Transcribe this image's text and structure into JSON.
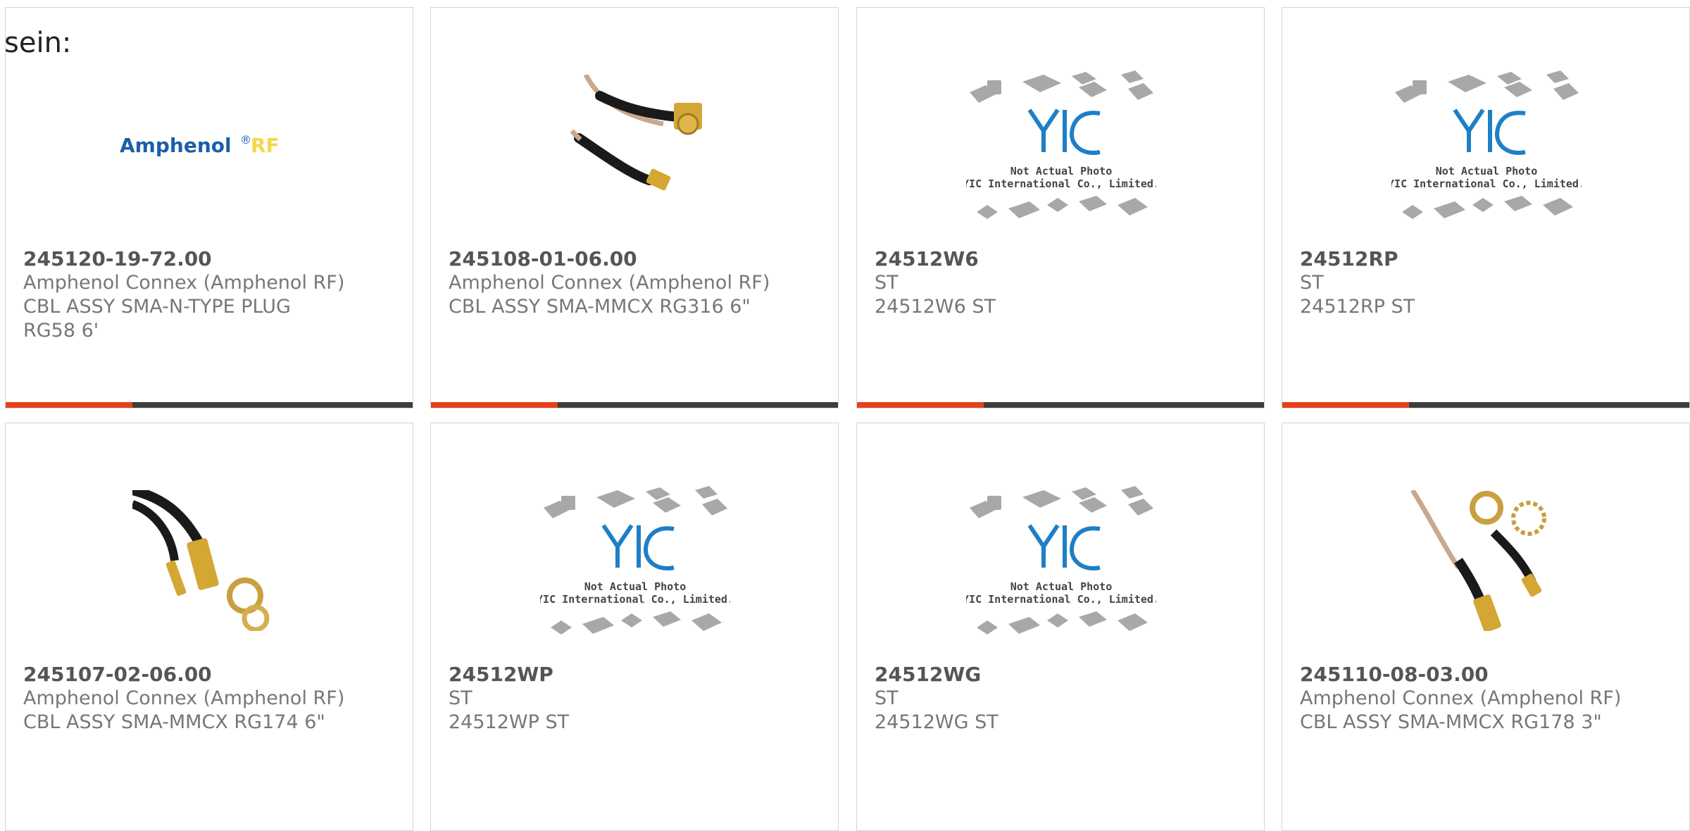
{
  "lead_text": "sein:",
  "products": [
    {
      "part_number": "245120-19-72.00",
      "manufacturer": "Amphenol Connex (Amphenol RF)",
      "description_1": "CBL ASSY SMA-N-TYPE PLUG",
      "description_2": "RG58 6'",
      "image": "amphenol-rf-logo"
    },
    {
      "part_number": "245108-01-06.00",
      "manufacturer": "Amphenol Connex (Amphenol RF)",
      "description_1": "CBL ASSY SMA-MMCX RG316 6\"",
      "description_2": "",
      "image": "cable-assembly-photo"
    },
    {
      "part_number": "24512W6",
      "manufacturer": "ST",
      "description_1": "24512W6 ST",
      "description_2": "",
      "image": "placeholder-photo"
    },
    {
      "part_number": "24512RP",
      "manufacturer": "ST",
      "description_1": "24512RP ST",
      "description_2": "",
      "image": "placeholder-photo"
    },
    {
      "part_number": "245107-02-06.00",
      "manufacturer": "Amphenol Connex (Amphenol RF)",
      "description_1": "CBL ASSY SMA-MMCX RG174 6\"",
      "description_2": "",
      "image": "cable-assembly-photo"
    },
    {
      "part_number": "24512WP",
      "manufacturer": "ST",
      "description_1": "24512WP ST",
      "description_2": "",
      "image": "placeholder-photo"
    },
    {
      "part_number": "24512WG",
      "manufacturer": "ST",
      "description_1": "24512WG ST",
      "description_2": "",
      "image": "placeholder-photo"
    },
    {
      "part_number": "245110-08-03.00",
      "manufacturer": "Amphenol Connex (Amphenol RF)",
      "description_1": "CBL ASSY SMA-MMCX RG178 3\"",
      "description_2": "",
      "image": "cable-assembly-photo"
    }
  ],
  "logo": {
    "brand": "Amphenol",
    "registered": "®",
    "suffix": "RF"
  },
  "placeholder": {
    "line1": "Not Actual Photo",
    "line2": "YIC International Co., Limited.",
    "mark": "YIC"
  },
  "colors": {
    "accent": "#e8401c",
    "bar": "#3d3d3d",
    "logo_blue": "#1a5fa8",
    "logo_yellow": "#f2d84b",
    "yic_blue": "#1e7fc6"
  }
}
